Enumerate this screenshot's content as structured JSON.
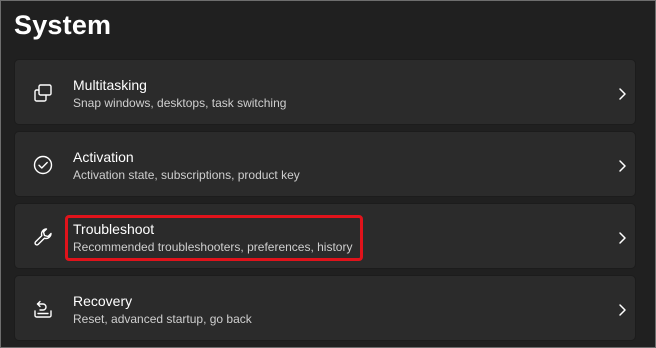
{
  "page": {
    "title": "System"
  },
  "items": [
    {
      "title": "Multitasking",
      "subtitle": "Snap windows, desktops, task switching",
      "icon": "multitasking-icon"
    },
    {
      "title": "Activation",
      "subtitle": "Activation state, subscriptions, product key",
      "icon": "check-circle-icon"
    },
    {
      "title": "Troubleshoot",
      "subtitle": "Recommended troubleshooters, preferences, history",
      "icon": "wrench-icon",
      "highlighted": true
    },
    {
      "title": "Recovery",
      "subtitle": "Reset, advanced startup, go back",
      "icon": "recovery-icon"
    }
  ],
  "colors": {
    "background": "#202020",
    "card": "#2b2b2b",
    "highlight": "#e0131b",
    "text_primary": "#ffffff",
    "text_secondary": "#cfcfcf"
  }
}
